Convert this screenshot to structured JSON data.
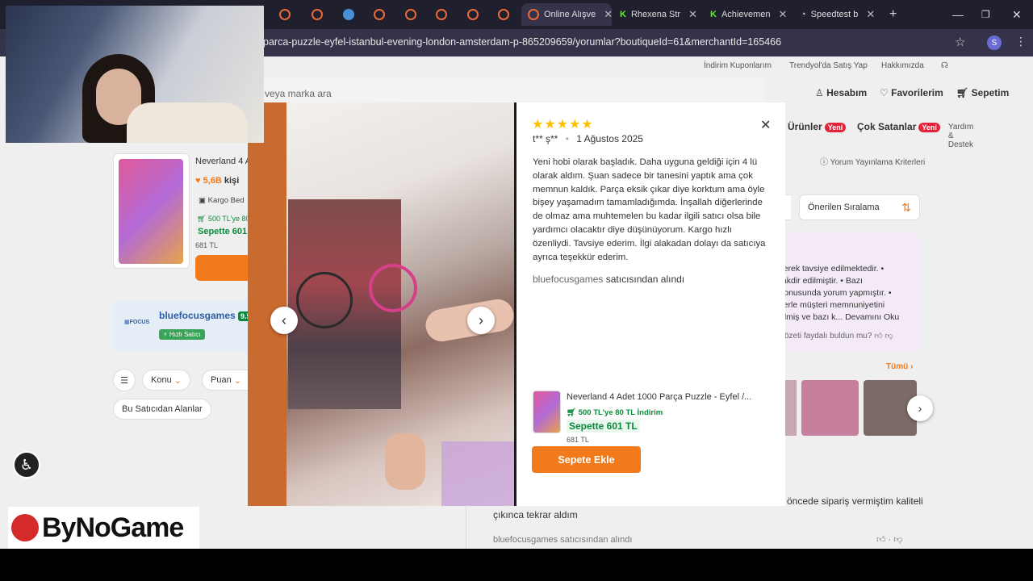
{
  "browser": {
    "tabs": [
      {
        "label": "Online Alışve",
        "active": true
      },
      {
        "label": "Rhexena Str"
      },
      {
        "label": "Achievemen"
      },
      {
        "label": "Speedtest b"
      }
    ],
    "url": "parca-puzzle-eyfel-istanbul-evening-london-amsterdam-p-865209659/yorumlar?boutiqueId=61&merchantId=165466",
    "profile_initial": "S"
  },
  "site": {
    "top_links": [
      "İndirim Kuponlarım",
      "Trendyol'da Satış Yap",
      "Hakkımızda",
      "Yardım & Destek"
    ],
    "search_placeholder": "ri veya marka ara",
    "account": "Hesabım",
    "favorites": "Favorilerim",
    "cart": "Sepetim",
    "categories": [
      {
        "label": "Ürünler",
        "badge": "Yeni"
      },
      {
        "label": "Çok Satanlar",
        "badge": "Yeni"
      }
    ],
    "review_criteria": "Yorum Yayınlama Kriterleri",
    "sort_label": "Önerilen Sıralama",
    "summary_lines": [
      "ilerek tavsiye edilmektedir. •",
      "takdir edilmiştir. • Bazı",
      "konusunda yorum yapmıştır. •",
      "ilerle müşteri memnuniyetini",
      "rilmiş ve bazı k... Devamını Oku"
    ],
    "summary_helpful": "özeti faydalı buldun mu?",
    "all_label": "Tümü",
    "product_title_short": "Neverland 4 A",
    "likes": "5,6B",
    "likes_suffix": "kişi",
    "cargo": "Kargo Bed",
    "discount_short": "500 TL'ye 80",
    "cart_price_short": "Sepette 601",
    "old_price": "681 TL",
    "seller_name": "bluefocusgames",
    "seller_score": "9.5",
    "fast_seller": "Hızlı Satıcı",
    "filters": [
      "Konu",
      "Puan"
    ],
    "seller_filter": "Bu Satıcıdan Alanlar",
    "bg_review_text_1": "öncede sipariş vermiştim kaliteli",
    "bg_review_text_2": "çıkınca tekrar aldım",
    "bg_seller_note": "bluefocusgames satıcısından alındı"
  },
  "review": {
    "stars": 5,
    "user": "t** ş**",
    "date": "1 Ağustos 2025",
    "text": "Yeni hobi olarak başladık. Daha uyguna geldiği için 4 lü olarak aldım. Şuan sadece bir tanesini yaptık ama çok memnun kaldık. Parça eksik çıkar diye korktum ama öyle bişey yaşamadım tamamladığımda. İnşallah diğerlerinde de olmaz ama muhtemelen bu kadar ilgili satıcı olsa bile yardımcı olacaktır diye düşünüyorum. Kargo hızlı özenliydi. Tavsiye ederim. İlgi alakadan dolayı da satıcıya ayrıca teşekkür ederim.",
    "seller": "bluefocusgames",
    "seller_suffix": "satıcısından alındı"
  },
  "modal_product": {
    "title": "Neverland 4 Adet 1000 Parça Puzzle - Eyfel /...",
    "discount": "500 TL'ye 80 TL İndirim",
    "cart_price": "Sepette 601 TL",
    "old_price": "681 TL",
    "add_to_cart": "Sepete Ekle"
  },
  "overlay": {
    "logo_text": "ByNoGame"
  },
  "colors": {
    "brand_orange": "#f27a1a",
    "green": "#0b8a3a",
    "star": "#ffc000",
    "badge_red": "#e4243b"
  }
}
